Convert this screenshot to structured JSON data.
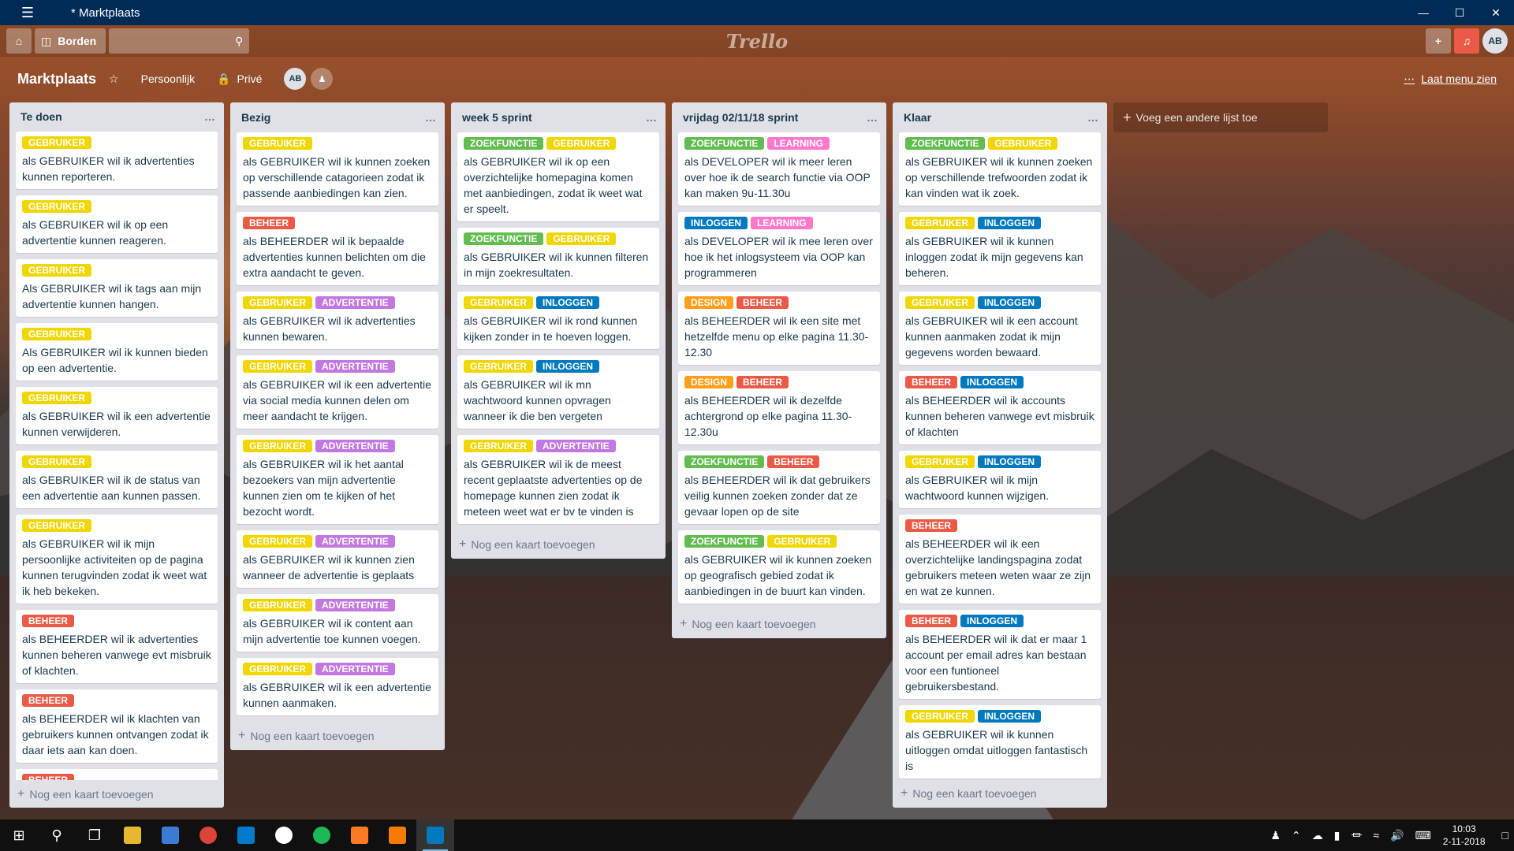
{
  "window": {
    "title": "* Marktplaats"
  },
  "header": {
    "boards_label": "Borden",
    "logo": "Trello",
    "avatar": "AB"
  },
  "board": {
    "name": "Marktplaats",
    "team": "Persoonlijk",
    "visibility": "Privé",
    "member": "AB",
    "show_menu": "Laat menu zien"
  },
  "colors": {
    "GEBRUIKER": "#f2d600",
    "BEHEER": "#eb5a46",
    "ADVERTENTIE": "#c377e0",
    "ZOEKFUNCTIE": "#61bd4f",
    "INLOGGEN": "#0079bf",
    "LEARNING": "#ff78cb",
    "DESIGN": "#ff9f1a"
  },
  "add_card_label": "Nog een kaart toevoegen",
  "add_list_label": "Voeg een andere lijst toe",
  "lists": [
    {
      "title": "Te doen",
      "cards": [
        {
          "labels": [
            "GEBRUIKER"
          ],
          "text": "als GEBRUIKER wil ik advertenties kunnen reporteren."
        },
        {
          "labels": [
            "GEBRUIKER"
          ],
          "text": "als GEBRUIKER wil ik op een advertentie kunnen reageren."
        },
        {
          "labels": [
            "GEBRUIKER"
          ],
          "text": "Als GEBRUIKER wil ik tags aan mijn advertentie kunnen hangen."
        },
        {
          "labels": [
            "GEBRUIKER"
          ],
          "text": "Als GEBRUIKER wil ik kunnen bieden op een advertentie."
        },
        {
          "labels": [
            "GEBRUIKER"
          ],
          "text": "als GEBRUIKER wil ik een advertentie kunnen verwijderen."
        },
        {
          "labels": [
            "GEBRUIKER"
          ],
          "text": "als GEBRUIKER wil ik de status van een advertentie aan kunnen passen."
        },
        {
          "labels": [
            "GEBRUIKER"
          ],
          "text": "als GEBRUIKER wil ik mijn persoonlijke activiteiten op de pagina kunnen terugvinden zodat ik weet wat ik heb bekeken."
        },
        {
          "labels": [
            "BEHEER"
          ],
          "text": "als BEHEERDER wil ik advertenties kunnen beheren vanwege evt misbruik of klachten."
        },
        {
          "labels": [
            "BEHEER"
          ],
          "text": "als BEHEERDER wil ik klachten van gebruikers kunnen ontvangen zodat ik daar iets aan kan doen."
        },
        {
          "labels": [
            "BEHEER"
          ],
          "text": ""
        }
      ]
    },
    {
      "title": "Bezig",
      "cards": [
        {
          "labels": [
            "GEBRUIKER"
          ],
          "text": "als GEBRUIKER wil ik kunnen zoeken op verschillende catagorieen zodat ik passende aanbiedingen kan zien."
        },
        {
          "labels": [
            "BEHEER"
          ],
          "text": "als BEHEERDER wil ik bepaalde advertenties kunnen belichten om die extra aandacht te geven."
        },
        {
          "labels": [
            "GEBRUIKER",
            "ADVERTENTIE"
          ],
          "text": "als GEBRUIKER wil ik advertenties kunnen bewaren."
        },
        {
          "labels": [
            "GEBRUIKER",
            "ADVERTENTIE"
          ],
          "text": "als GEBRUIKER wil ik een advertentie via social media kunnen delen om meer aandacht te krijgen."
        },
        {
          "labels": [
            "GEBRUIKER",
            "ADVERTENTIE"
          ],
          "text": "als GEBRUIKER wil ik het aantal bezoekers van mijn advertentie kunnen zien om te kijken of het bezocht wordt."
        },
        {
          "labels": [
            "GEBRUIKER",
            "ADVERTENTIE"
          ],
          "text": "als GEBRUIKER wil ik kunnen zien wanneer de advertentie is geplaats"
        },
        {
          "labels": [
            "GEBRUIKER",
            "ADVERTENTIE"
          ],
          "text": "als GEBRUIKER wil ik content aan mijn advertentie toe kunnen voegen."
        },
        {
          "labels": [
            "GEBRUIKER",
            "ADVERTENTIE"
          ],
          "text": "als GEBRUIKER wil ik een advertentie kunnen aanmaken."
        }
      ]
    },
    {
      "title": "week 5 sprint",
      "cards": [
        {
          "labels": [
            "ZOEKFUNCTIE",
            "GEBRUIKER"
          ],
          "text": "als GEBRUIKER wil ik op een overzichtelijke homepagina komen met aanbiedingen, zodat ik weet wat er speelt."
        },
        {
          "labels": [
            "ZOEKFUNCTIE",
            "GEBRUIKER"
          ],
          "text": "als GEBRUIKER wil ik kunnen filteren in mijn zoekresultaten."
        },
        {
          "labels": [
            "GEBRUIKER",
            "INLOGGEN"
          ],
          "text": "als GEBRUIKER wil ik rond kunnen kijken zonder in te hoeven loggen."
        },
        {
          "labels": [
            "GEBRUIKER",
            "INLOGGEN"
          ],
          "text": "als GEBRUIKER wil ik mn wachtwoord kunnen opvragen wanneer ik die ben vergeten"
        },
        {
          "labels": [
            "GEBRUIKER",
            "ADVERTENTIE"
          ],
          "text": "als GEBRUIKER wil ik de meest recent geplaatste advertenties op de homepage kunnen zien zodat ik meteen weet wat er bv te vinden is"
        }
      ]
    },
    {
      "title": "vrijdag 02/11/18 sprint",
      "cards": [
        {
          "labels": [
            "ZOEKFUNCTIE",
            "LEARNING"
          ],
          "text": "als DEVELOPER wil ik meer leren over hoe ik de search functie via OOP kan maken 9u-11.30u"
        },
        {
          "labels": [
            "INLOGGEN",
            "LEARNING"
          ],
          "text": "als DEVELOPER wil ik mee leren over hoe ik het inlogsysteem via OOP kan programmeren"
        },
        {
          "labels": [
            "DESIGN",
            "BEHEER"
          ],
          "text": "als BEHEERDER wil ik een site met hetzelfde menu op elke pagina 11.30-12.30"
        },
        {
          "labels": [
            "DESIGN",
            "BEHEER"
          ],
          "text": "als BEHEERDER wil ik dezelfde achtergrond op elke pagina 11.30-12.30u"
        },
        {
          "labels": [
            "ZOEKFUNCTIE",
            "BEHEER"
          ],
          "text": "als BEHEERDER wil ik dat gebruikers veilig kunnen zoeken zonder dat ze gevaar lopen op de site"
        },
        {
          "labels": [
            "ZOEKFUNCTIE",
            "GEBRUIKER"
          ],
          "text": "als GEBRUIKER wil ik kunnen zoeken op geografisch gebied zodat ik aanbiedingen in de buurt kan vinden."
        }
      ]
    },
    {
      "title": "Klaar",
      "cards": [
        {
          "labels": [
            "ZOEKFUNCTIE",
            "GEBRUIKER"
          ],
          "text": "als GEBRUIKER wil ik kunnen zoeken op verschillende trefwoorden zodat ik kan vinden wat ik zoek."
        },
        {
          "labels": [
            "GEBRUIKER",
            "INLOGGEN"
          ],
          "text": "als GEBRUIKER wil ik kunnen inloggen zodat ik mijn gegevens kan beheren."
        },
        {
          "labels": [
            "GEBRUIKER",
            "INLOGGEN"
          ],
          "text": "als GEBRUIKER wil ik een account kunnen aanmaken zodat ik mijn gegevens worden bewaard."
        },
        {
          "labels": [
            "BEHEER",
            "INLOGGEN"
          ],
          "text": "als BEHEERDER wil ik accounts kunnen beheren vanwege evt misbruik of klachten"
        },
        {
          "labels": [
            "GEBRUIKER",
            "INLOGGEN"
          ],
          "text": "als GEBRUIKER wil ik mijn wachtwoord kunnen wijzigen."
        },
        {
          "labels": [
            "BEHEER"
          ],
          "text": "als BEHEERDER wil ik een overzichtelijke landingspagina zodat gebruikers meteen weten waar ze zijn en wat ze kunnen."
        },
        {
          "labels": [
            "BEHEER",
            "INLOGGEN"
          ],
          "text": "als BEHEERDER wil ik dat er maar 1 account per email adres kan bestaan voor een funtioneel gebruikersbestand."
        },
        {
          "labels": [
            "GEBRUIKER",
            "INLOGGEN"
          ],
          "text": "als GEBRUIKER wil ik kunnen uitloggen omdat uitloggen fantastisch is"
        }
      ]
    }
  ],
  "taskbar": {
    "time": "10:03",
    "date": "2-11-2018"
  }
}
